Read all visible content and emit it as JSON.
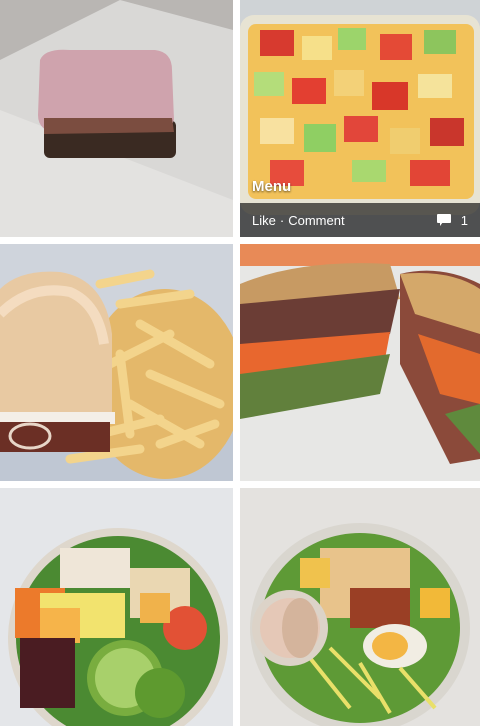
{
  "photos": [
    {
      "id": "cake",
      "icon": "cake-photo"
    },
    {
      "id": "fruit",
      "icon": "fruit-salad-photo",
      "caption": "Menu",
      "actions": {
        "like": "Like",
        "separator": "·",
        "comment": "Comment",
        "comment_count": "1"
      }
    },
    {
      "id": "burger",
      "icon": "burger-fries-photo"
    },
    {
      "id": "sandwich",
      "icon": "sandwich-photo"
    },
    {
      "id": "salad1",
      "icon": "salad-photo"
    },
    {
      "id": "salad2",
      "icon": "salad-photo"
    }
  ]
}
